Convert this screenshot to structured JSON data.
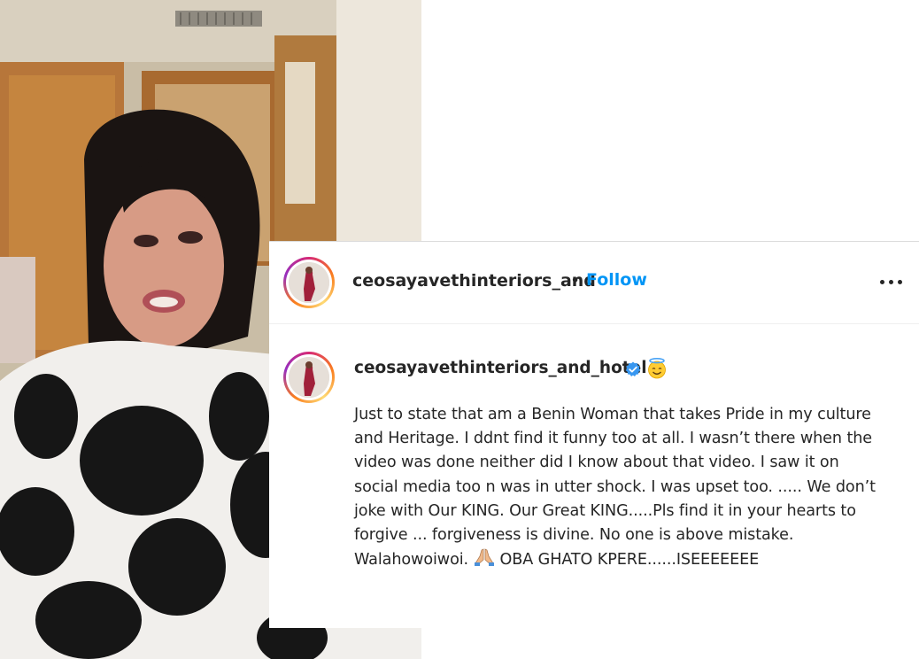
{
  "post": {
    "header": {
      "username": "ceosayavethinteriors_and",
      "separator": "•",
      "follow_label": "Follow",
      "more_icon": "more-options-icon"
    },
    "caption": {
      "username": "ceosayavethinteriors_and_hotel",
      "verified_icon": "verified-badge-icon",
      "emoji_icon": "smiling-face-with-halo-emoji",
      "lines": [
        "Just to state that am a Benin Woman that takes Pride in my culture",
        "and Heritage. I ddnt find it funny too at all. I wasn’t there when the",
        "video was done neither did I know about that video. I saw it on",
        "social media too n was in utter shock. I was upset too. ..... We don’t",
        "joke with Our KING. Our Great KING.....Pls find it in your hearts to",
        "forgive ... forgiveness is divine. No one is above mistake.",
        "Walahowoiwoi."
      ],
      "last_line_after_emoji": "OBA GHATO KPERE......ISEEEEEEE",
      "pray_icon": "folded-hands-emoji"
    },
    "colors": {
      "follow_blue": "#0095f6",
      "verified_blue": "#3897f0",
      "text": "#262626"
    }
  }
}
